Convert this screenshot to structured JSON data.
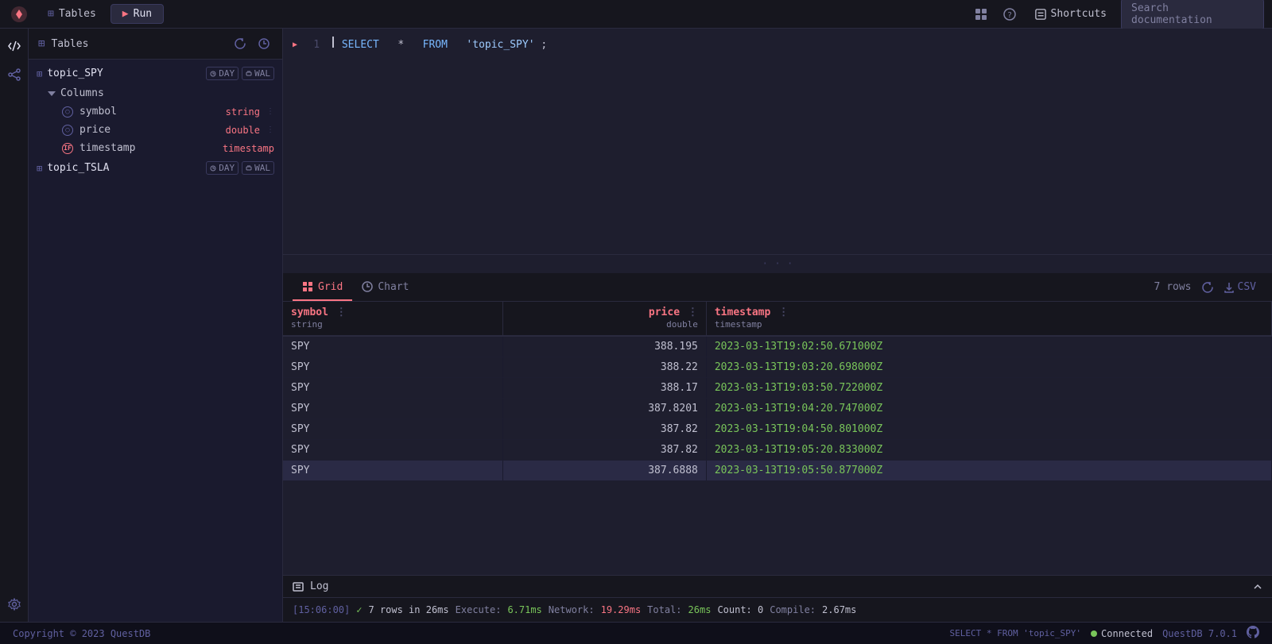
{
  "nav": {
    "tables_label": "Tables",
    "run_label": "Run",
    "shortcuts_label": "Shortcuts",
    "search_placeholder": "Search documentation"
  },
  "tables_panel": {
    "title": "Tables",
    "tables": [
      {
        "name": "topic_SPY",
        "tags": [
          "DAY",
          "WAL"
        ],
        "columns": [
          {
            "name": "symbol",
            "type": "string",
            "icon": "circle"
          },
          {
            "name": "price",
            "type": "double",
            "icon": "circle"
          },
          {
            "name": "timestamp",
            "type": "timestamp",
            "icon": "ts"
          }
        ]
      },
      {
        "name": "topic_TSLA",
        "tags": [
          "DAY",
          "WAL"
        ]
      }
    ]
  },
  "editor": {
    "line_number": "1",
    "code": "SELECT * FROM 'topic_SPY';"
  },
  "results": {
    "grid_tab": "Grid",
    "chart_tab": "Chart",
    "rows_count": "7 rows",
    "csv_label": "CSV",
    "columns": [
      {
        "name": "symbol",
        "type": "string"
      },
      {
        "name": "price",
        "type": "double"
      },
      {
        "name": "timestamp",
        "type": "timestamp"
      }
    ],
    "rows": [
      {
        "symbol": "SPY",
        "price": "388.195",
        "timestamp": "2023-03-13T19:02:50.671000Z"
      },
      {
        "symbol": "SPY",
        "price": "388.22",
        "timestamp": "2023-03-13T19:03:20.698000Z"
      },
      {
        "symbol": "SPY",
        "price": "388.17",
        "timestamp": "2023-03-13T19:03:50.722000Z"
      },
      {
        "symbol": "SPY",
        "price": "387.8201",
        "timestamp": "2023-03-13T19:04:20.747000Z"
      },
      {
        "symbol": "SPY",
        "price": "387.82",
        "timestamp": "2023-03-13T19:04:50.801000Z"
      },
      {
        "symbol": "SPY",
        "price": "387.82",
        "timestamp": "2023-03-13T19:05:20.833000Z"
      },
      {
        "symbol": "SPY",
        "price": "387.6888",
        "timestamp": "2023-03-13T19:05:50.877000Z"
      }
    ]
  },
  "log": {
    "title": "Log",
    "time": "[15:06:00]",
    "check_symbol": "✓",
    "summary": "7 rows in 26ms",
    "execute_label": "Execute:",
    "execute_val": "6.71ms",
    "network_label": "Network:",
    "network_val": "19.29ms",
    "total_label": "Total:",
    "total_val": "26ms",
    "count_label": "Count: 0",
    "compile_label": "Compile:",
    "compile_val": "2.67ms"
  },
  "status": {
    "copyright": "Copyright © 2023 QuestDB",
    "last_query": "SELECT * FROM 'topic_SPY'",
    "connected_label": "Connected",
    "version_label": "QuestDB 7.0.1"
  }
}
